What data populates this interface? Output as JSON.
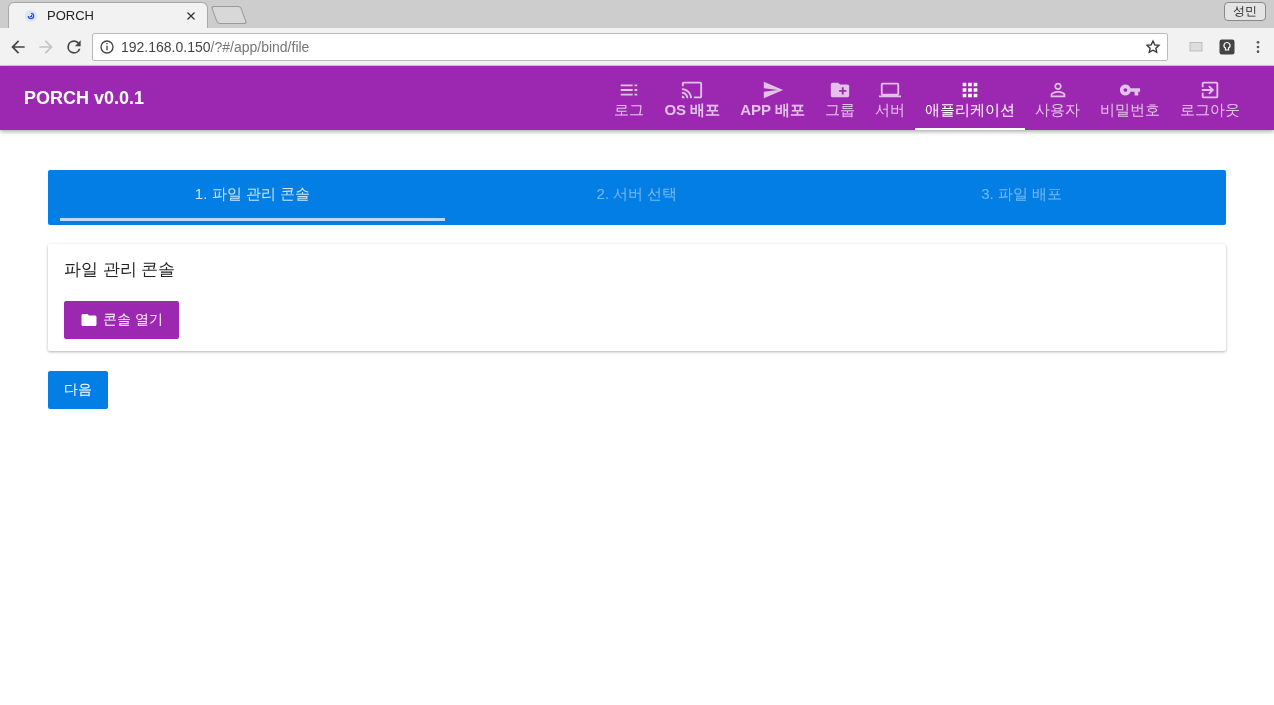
{
  "browser": {
    "tab_title": "PORCH",
    "profile": "성민",
    "url": {
      "host": "192.168.0.150",
      "path": "/?#/app/bind/file"
    },
    "forward_disabled": true
  },
  "app_bar": {
    "title": "PORCH v0.0.1",
    "nav": [
      {
        "label": "로그",
        "kind": "list",
        "selected": false
      },
      {
        "label": "OS 배포",
        "kind": "cast",
        "selected": false
      },
      {
        "label": "APP 배포",
        "kind": "send",
        "selected": false
      },
      {
        "label": "그룹",
        "kind": "folder",
        "selected": false
      },
      {
        "label": "서버",
        "kind": "laptop",
        "selected": false
      },
      {
        "label": "애플리케이션",
        "kind": "apps",
        "selected": true
      },
      {
        "label": "사용자",
        "kind": "person",
        "selected": false
      },
      {
        "label": "비밀번호",
        "kind": "key",
        "selected": false
      },
      {
        "label": "로그아웃",
        "kind": "logout",
        "selected": false
      }
    ]
  },
  "stepper": [
    {
      "label": "1. 파일 관리 콘솔",
      "selected": true
    },
    {
      "label": "2. 서버 선택",
      "selected": false
    },
    {
      "label": "3. 파일 배포",
      "selected": false
    }
  ],
  "card": {
    "title": "파일 관리 콘솔",
    "button": "콘솔 열기"
  },
  "next_button": "다음"
}
